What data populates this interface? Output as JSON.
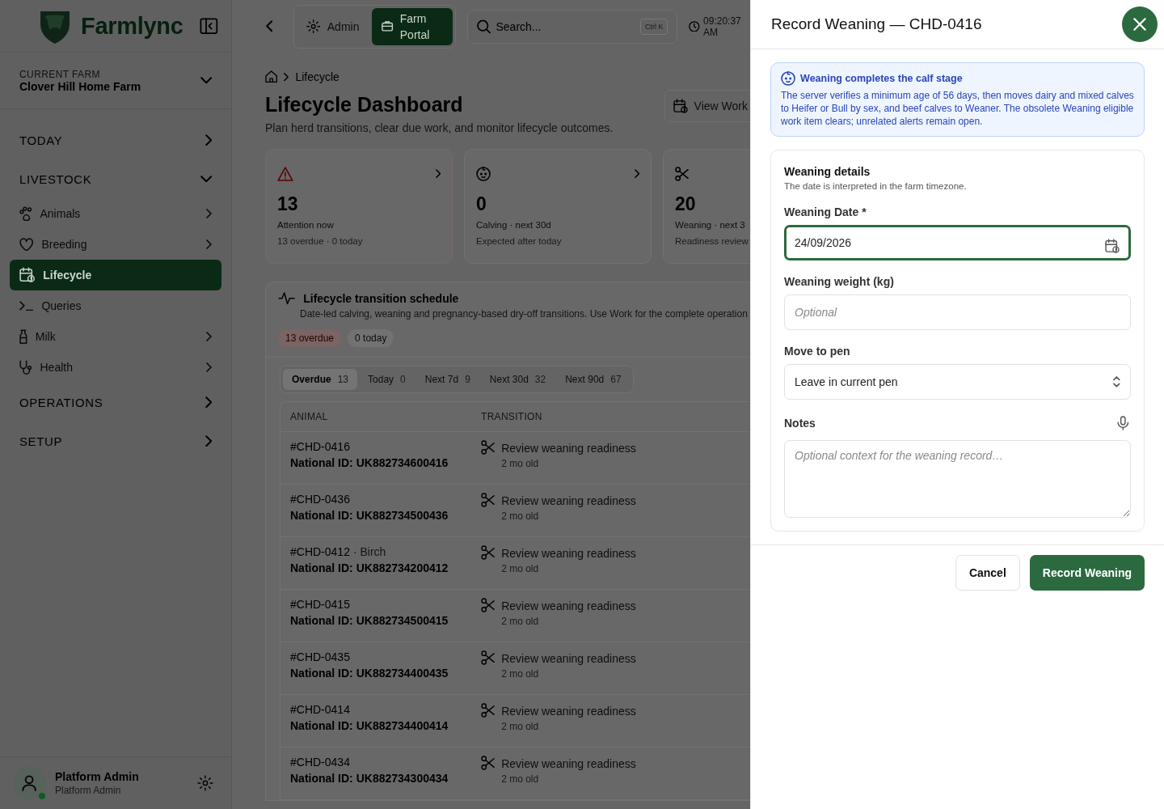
{
  "sidebar": {
    "logo": "Farmlync",
    "farm": {
      "label": "CURRENT FARM",
      "name": "Clover Hill Home Farm"
    },
    "sections": [
      {
        "label": "TODAY",
        "expanded": false
      },
      {
        "label": "LIVESTOCK",
        "expanded": true,
        "items": [
          {
            "label": "Animals",
            "submenu": true,
            "selected": false
          },
          {
            "label": "Breeding",
            "submenu": true,
            "selected": false
          },
          {
            "label": "Lifecycle",
            "submenu": false,
            "selected": true
          },
          {
            "label": "Queries",
            "submenu": false,
            "selected": false
          },
          {
            "label": "Milk",
            "submenu": true,
            "selected": false
          },
          {
            "label": "Health",
            "submenu": true,
            "selected": false
          }
        ]
      },
      {
        "label": "OPERATIONS",
        "expanded": false
      },
      {
        "label": "SETUP",
        "expanded": false
      }
    ],
    "user": {
      "name": "Platform Admin",
      "role": "Platform Admin",
      "online": true
    }
  },
  "topbar": {
    "modes": [
      {
        "label": "Admin",
        "selected": false
      },
      {
        "label": "Farm Portal",
        "selected": true
      }
    ],
    "search": {
      "placeholder": "Search...",
      "shortcut": "Ctrl K"
    },
    "time": "09:20:37 AM"
  },
  "breadcrumb": [
    "Lifecycle"
  ],
  "page": {
    "title": "Lifecycle Dashboard",
    "subtitle": "Plan herd transitions, clear due work, and monitor lifecycle outcomes.",
    "action": "View Work"
  },
  "stats": [
    {
      "value": "13",
      "label": "Attention now",
      "sub": "13 overdue · 0 today",
      "kind": "alert",
      "link": true
    },
    {
      "value": "0",
      "label": "Calving · next 30d",
      "sub": "Expected after today",
      "kind": "calving",
      "link": true
    },
    {
      "value": "20",
      "label": "Weaning · next 3",
      "sub": "Readiness review",
      "kind": "weaning",
      "link": false
    }
  ],
  "schedule": {
    "title": "Lifecycle transition schedule",
    "description": "Date-led calving, weaning and pregnancy-based dry-off transitions. Use Work for the complete operation",
    "badges": [
      {
        "label": "13 overdue",
        "kind": "alert"
      },
      {
        "label": "0 today",
        "kind": "neutral"
      }
    ],
    "tabs": [
      {
        "label": "Overdue",
        "count": "13",
        "selected": true
      },
      {
        "label": "Today",
        "count": "0",
        "selected": false
      },
      {
        "label": "Next 7d",
        "count": "9",
        "selected": false
      },
      {
        "label": "Next 30d",
        "count": "32",
        "selected": false
      },
      {
        "label": "Next 90d",
        "count": "67",
        "selected": false
      }
    ],
    "table": {
      "columns": [
        "ANIMAL",
        "TRANSITION"
      ],
      "rows": [
        {
          "animal": "#CHD-0416",
          "national_id": "National ID: UK882734600416",
          "transition": "Review weaning readiness",
          "age": "2 mo old"
        },
        {
          "animal": "#CHD-0436",
          "national_id": "National ID: UK882734500436",
          "transition": "Review weaning readiness",
          "age": "2 mo old"
        },
        {
          "animal": "#CHD-0412",
          "name": "· Birch",
          "national_id": "National ID: UK882734200412",
          "transition": "Review weaning readiness",
          "age": "2 mo old"
        },
        {
          "animal": "#CHD-0415",
          "national_id": "National ID: UK882734500415",
          "transition": "Review weaning readiness",
          "age": "2 mo old"
        },
        {
          "animal": "#CHD-0435",
          "national_id": "National ID: UK882734400435",
          "transition": "Review weaning readiness",
          "age": "2 mo old"
        },
        {
          "animal": "#CHD-0414",
          "national_id": "National ID: UK882734400414",
          "transition": "Review weaning readiness",
          "age": "2 mo old"
        },
        {
          "animal": "#CHD-0434",
          "national_id": "National ID: UK882734300434",
          "transition": "Review weaning readiness",
          "age": "2 mo old"
        }
      ]
    }
  },
  "drawer": {
    "title": "Record Weaning — CHD-0416",
    "info": {
      "title": "Weaning completes the calf stage",
      "body": "The server verifies a minimum age of 56 days, then moves dairy and mixed calves to Heifer or Bull by sex, and beef calves to Weaner. The obsolete Weaning eligible work item clears; unrelated alerts remain open."
    },
    "details": {
      "title": "Weaning details",
      "subtitle": "The date is interpreted in the farm timezone."
    },
    "fields": [
      {
        "kind": "date",
        "label": "Weaning Date *",
        "value": "24/09/2026",
        "focused": true
      },
      {
        "kind": "text",
        "label": "Weaning weight (kg)",
        "placeholder": "Optional",
        "focused": false
      },
      {
        "kind": "select",
        "label": "Move to pen",
        "value": "Leave in current pen",
        "focused": false
      },
      {
        "kind": "textarea",
        "label": "Notes",
        "placeholder": "Optional context for the weaning record…",
        "focused": false,
        "dictation": true
      }
    ],
    "buttons": [
      {
        "label": "Cancel",
        "kind": "secondary"
      },
      {
        "label": "Record Weaning",
        "kind": "primary"
      }
    ]
  }
}
